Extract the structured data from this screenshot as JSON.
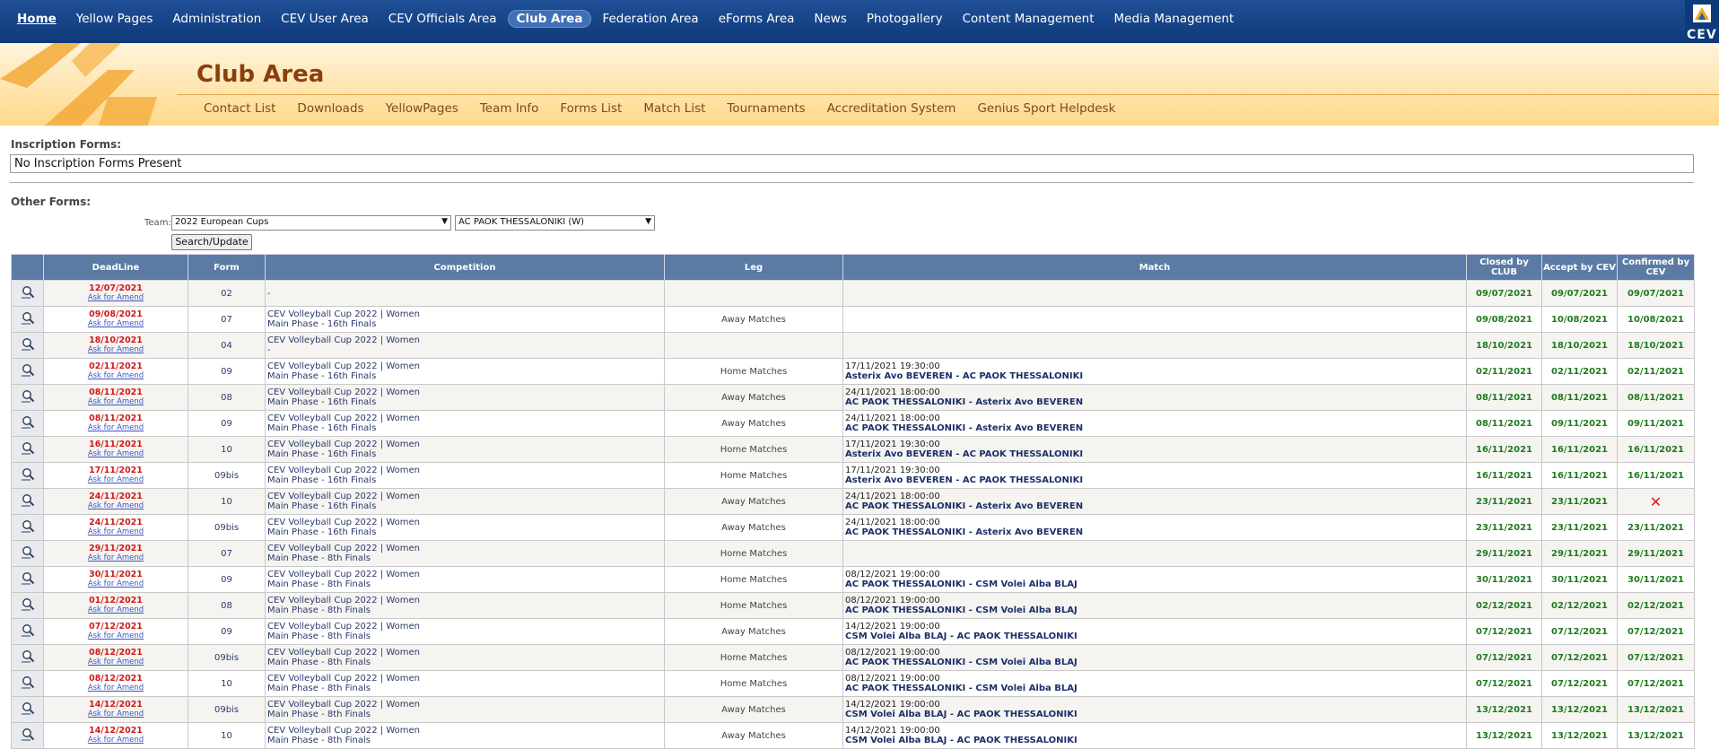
{
  "topnav": {
    "items": [
      "Home",
      "Yellow Pages",
      "Administration",
      "CEV User Area",
      "CEV Officials Area",
      "Club Area",
      "Federation Area",
      "eForms Area",
      "News",
      "Photogallery",
      "Content Management",
      "Media Management"
    ],
    "active": "Club Area",
    "logo_text": "CEV"
  },
  "header": {
    "title": "Club Area",
    "subnav": [
      "Contact List",
      "Downloads",
      "YellowPages",
      "Team Info",
      "Forms List",
      "Match List",
      "Tournaments",
      "Accreditation System",
      "Genius Sport Helpdesk"
    ]
  },
  "inscription": {
    "label": "Inscription Forms:",
    "empty_text": "No Inscription Forms Present"
  },
  "other": {
    "label": "Other Forms:",
    "team_label": "Team:",
    "season_value": "2022 European Cups",
    "team_value": "AC PAOK THESSALONIKI (W)",
    "search_button": "Search/Update"
  },
  "table": {
    "headers": [
      "",
      "DeadLine",
      "Form",
      "Competition",
      "Leg",
      "Match",
      "Closed by CLUB",
      "Accept by CEV",
      "Confirmed by CEV"
    ],
    "amend_label": "Ask for Amend",
    "rows": [
      {
        "deadline": "12/07/2021",
        "form": "02",
        "comp1": "-",
        "comp2": "",
        "leg": "",
        "match_time": "",
        "match_teams": "",
        "closed": "09/07/2021",
        "accept": "09/07/2021",
        "confirmed": "09/07/2021"
      },
      {
        "deadline": "09/08/2021",
        "form": "07",
        "comp1": "CEV Volleyball Cup 2022 | Women",
        "comp2": "Main Phase - 16th Finals",
        "leg": "Away Matches",
        "match_time": "",
        "match_teams": "",
        "closed": "09/08/2021",
        "accept": "10/08/2021",
        "confirmed": "10/08/2021"
      },
      {
        "deadline": "18/10/2021",
        "form": "04",
        "comp1": "CEV Volleyball Cup 2022 | Women",
        "comp2": "-",
        "leg": "",
        "match_time": "",
        "match_teams": "",
        "closed": "18/10/2021",
        "accept": "18/10/2021",
        "confirmed": "18/10/2021"
      },
      {
        "deadline": "02/11/2021",
        "form": "09",
        "comp1": "CEV Volleyball Cup 2022 | Women",
        "comp2": "Main Phase - 16th Finals",
        "leg": "Home Matches",
        "match_time": "17/11/2021 19:30:00",
        "match_teams": "Asterix Avo BEVEREN - AC PAOK THESSALONIKI",
        "closed": "02/11/2021",
        "accept": "02/11/2021",
        "confirmed": "02/11/2021"
      },
      {
        "deadline": "08/11/2021",
        "form": "08",
        "comp1": "CEV Volleyball Cup 2022 | Women",
        "comp2": "Main Phase - 16th Finals",
        "leg": "Away Matches",
        "match_time": "24/11/2021 18:00:00",
        "match_teams": "AC PAOK THESSALONIKI - Asterix Avo BEVEREN",
        "closed": "08/11/2021",
        "accept": "08/11/2021",
        "confirmed": "08/11/2021"
      },
      {
        "deadline": "08/11/2021",
        "form": "09",
        "comp1": "CEV Volleyball Cup 2022 | Women",
        "comp2": "Main Phase - 16th Finals",
        "leg": "Away Matches",
        "match_time": "24/11/2021 18:00:00",
        "match_teams": "AC PAOK THESSALONIKI - Asterix Avo BEVEREN",
        "closed": "08/11/2021",
        "accept": "09/11/2021",
        "confirmed": "09/11/2021"
      },
      {
        "deadline": "16/11/2021",
        "form": "10",
        "comp1": "CEV Volleyball Cup 2022 | Women",
        "comp2": "Main Phase - 16th Finals",
        "leg": "Home Matches",
        "match_time": "17/11/2021 19:30:00",
        "match_teams": "Asterix Avo BEVEREN - AC PAOK THESSALONIKI",
        "closed": "16/11/2021",
        "accept": "16/11/2021",
        "confirmed": "16/11/2021"
      },
      {
        "deadline": "17/11/2021",
        "form": "09bis",
        "comp1": "CEV Volleyball Cup 2022 | Women",
        "comp2": "Main Phase - 16th Finals",
        "leg": "Home Matches",
        "match_time": "17/11/2021 19:30:00",
        "match_teams": "Asterix Avo BEVEREN - AC PAOK THESSALONIKI",
        "closed": "16/11/2021",
        "accept": "16/11/2021",
        "confirmed": "16/11/2021"
      },
      {
        "deadline": "24/11/2021",
        "form": "10",
        "comp1": "CEV Volleyball Cup 2022 | Women",
        "comp2": "Main Phase - 16th Finals",
        "leg": "Away Matches",
        "match_time": "24/11/2021 18:00:00",
        "match_teams": "AC PAOK THESSALONIKI - Asterix Avo BEVEREN",
        "closed": "23/11/2021",
        "accept": "23/11/2021",
        "confirmed": "✕"
      },
      {
        "deadline": "24/11/2021",
        "form": "09bis",
        "comp1": "CEV Volleyball Cup 2022 | Women",
        "comp2": "Main Phase - 16th Finals",
        "leg": "Away Matches",
        "match_time": "24/11/2021 18:00:00",
        "match_teams": "AC PAOK THESSALONIKI - Asterix Avo BEVEREN",
        "closed": "23/11/2021",
        "accept": "23/11/2021",
        "confirmed": "23/11/2021"
      },
      {
        "deadline": "29/11/2021",
        "form": "07",
        "comp1": "CEV Volleyball Cup 2022 | Women",
        "comp2": "Main Phase - 8th Finals",
        "leg": "Home Matches",
        "match_time": "",
        "match_teams": "",
        "closed": "29/11/2021",
        "accept": "29/11/2021",
        "confirmed": "29/11/2021"
      },
      {
        "deadline": "30/11/2021",
        "form": "09",
        "comp1": "CEV Volleyball Cup 2022 | Women",
        "comp2": "Main Phase - 8th Finals",
        "leg": "Home Matches",
        "match_time": "08/12/2021 19:00:00",
        "match_teams": "AC PAOK THESSALONIKI - CSM Volei Alba BLAJ",
        "closed": "30/11/2021",
        "accept": "30/11/2021",
        "confirmed": "30/11/2021"
      },
      {
        "deadline": "01/12/2021",
        "form": "08",
        "comp1": "CEV Volleyball Cup 2022 | Women",
        "comp2": "Main Phase - 8th Finals",
        "leg": "Home Matches",
        "match_time": "08/12/2021 19:00:00",
        "match_teams": "AC PAOK THESSALONIKI - CSM Volei Alba BLAJ",
        "closed": "02/12/2021",
        "accept": "02/12/2021",
        "confirmed": "02/12/2021"
      },
      {
        "deadline": "07/12/2021",
        "form": "09",
        "comp1": "CEV Volleyball Cup 2022 | Women",
        "comp2": "Main Phase - 8th Finals",
        "leg": "Away Matches",
        "match_time": "14/12/2021 19:00:00",
        "match_teams": "CSM Volei Alba BLAJ - AC PAOK THESSALONIKI",
        "closed": "07/12/2021",
        "accept": "07/12/2021",
        "confirmed": "07/12/2021"
      },
      {
        "deadline": "08/12/2021",
        "form": "09bis",
        "comp1": "CEV Volleyball Cup 2022 | Women",
        "comp2": "Main Phase - 8th Finals",
        "leg": "Home Matches",
        "match_time": "08/12/2021 19:00:00",
        "match_teams": "AC PAOK THESSALONIKI - CSM Volei Alba BLAJ",
        "closed": "07/12/2021",
        "accept": "07/12/2021",
        "confirmed": "07/12/2021"
      },
      {
        "deadline": "08/12/2021",
        "form": "10",
        "comp1": "CEV Volleyball Cup 2022 | Women",
        "comp2": "Main Phase - 8th Finals",
        "leg": "Home Matches",
        "match_time": "08/12/2021 19:00:00",
        "match_teams": "AC PAOK THESSALONIKI - CSM Volei Alba BLAJ",
        "closed": "07/12/2021",
        "accept": "07/12/2021",
        "confirmed": "07/12/2021"
      },
      {
        "deadline": "14/12/2021",
        "form": "09bis",
        "comp1": "CEV Volleyball Cup 2022 | Women",
        "comp2": "Main Phase - 8th Finals",
        "leg": "Away Matches",
        "match_time": "14/12/2021 19:00:00",
        "match_teams": "CSM Volei Alba BLAJ - AC PAOK THESSALONIKI",
        "closed": "13/12/2021",
        "accept": "13/12/2021",
        "confirmed": "13/12/2021"
      },
      {
        "deadline": "14/12/2021",
        "form": "10",
        "comp1": "CEV Volleyball Cup 2022 | Women",
        "comp2": "Main Phase - 8th Finals",
        "leg": "Away Matches",
        "match_time": "14/12/2021 19:00:00",
        "match_teams": "CSM Volei Alba BLAJ - AC PAOK THESSALONIKI",
        "closed": "13/12/2021",
        "accept": "13/12/2021",
        "confirmed": "13/12/2021"
      }
    ]
  }
}
